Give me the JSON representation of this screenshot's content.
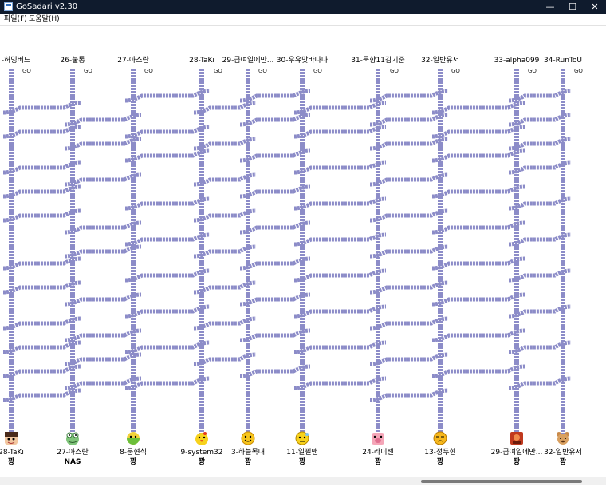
{
  "window": {
    "title": "GoSadari v2.30",
    "minimize": "—",
    "maximize": "☐",
    "close": "✕"
  },
  "menu": {
    "file": "파일(F)",
    "help": "도움말(H)"
  },
  "go_label": "GO",
  "players": [
    "-허밍버드",
    "26-불롱",
    "27-아스란",
    "28-TaKi",
    "29-급여일에만...",
    "30-우유맛바나나",
    "31-묵향11김기준",
    "32-일반유저",
    "33-alpha099",
    "34-RunToU"
  ],
  "results": [
    {
      "name": "28-TaKi",
      "result": "꽝",
      "icon": "boy-face-icon"
    },
    {
      "name": "27-아스란",
      "result": "NAS",
      "icon": "frog-face-icon"
    },
    {
      "name": "8-문현식",
      "result": "꽝",
      "icon": "green-smiley-icon"
    },
    {
      "name": "9-system32",
      "result": "꽝",
      "icon": "yellow-chick-icon"
    },
    {
      "name": "3-하늘목대",
      "result": "꽝",
      "icon": "yellow-smiley-icon"
    },
    {
      "name": "11-일필맨",
      "result": "꽝",
      "icon": "sweat-smiley-icon"
    },
    {
      "name": "24-라이젠",
      "result": "꽝",
      "icon": "pig-face-icon"
    },
    {
      "name": "13-정두현",
      "result": "꽝",
      "icon": "tired-smiley-icon"
    },
    {
      "name": "29-급여일에만...",
      "result": "꽝",
      "icon": "red-square-icon"
    },
    {
      "name": "32-일반유저",
      "result": "꽝",
      "icon": "bear-icon"
    }
  ],
  "colors": {
    "titlebar": "#0f1b2d",
    "rail": "#8c8cc8",
    "rail_dark": "#5e5ea8"
  }
}
